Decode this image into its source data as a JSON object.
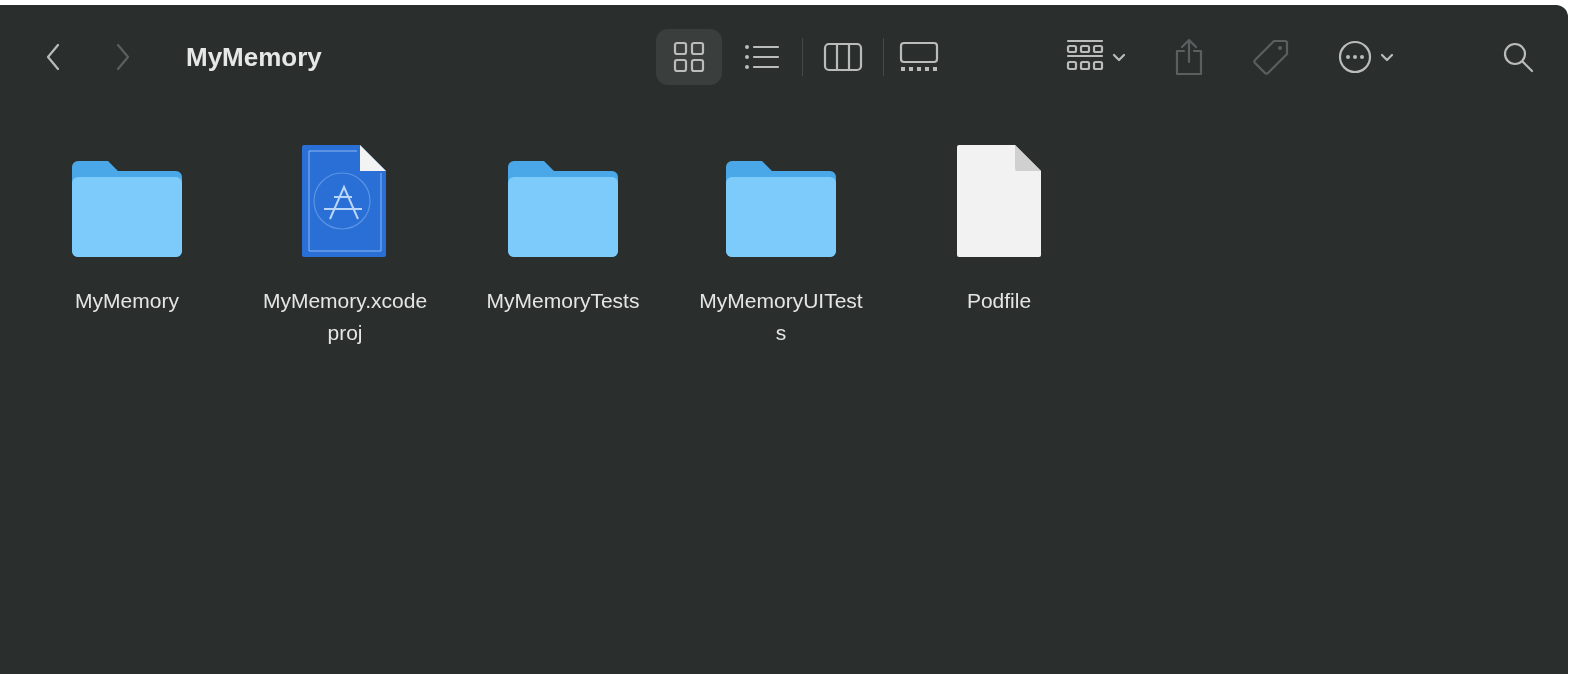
{
  "window": {
    "title": "MyMemory"
  },
  "navigation": [
    {
      "kind": "back",
      "disabled": false
    },
    {
      "kind": "forward",
      "disabled": true
    }
  ],
  "view_modes": [
    {
      "kind": "icons",
      "selected": true
    },
    {
      "kind": "list",
      "selected": false
    },
    {
      "kind": "columns",
      "selected": false
    },
    {
      "kind": "gallery",
      "selected": false
    }
  ],
  "toolbar": [
    {
      "kind": "group",
      "disabled": false
    },
    {
      "kind": "share",
      "disabled": true
    },
    {
      "kind": "tag",
      "disabled": true
    },
    {
      "kind": "more",
      "disabled": false
    },
    {
      "kind": "search",
      "disabled": false
    }
  ],
  "files": [
    {
      "kind": "folder",
      "label_lines": [
        "MyMemory"
      ]
    },
    {
      "kind": "xcodeproj",
      "label_lines": [
        "MyMemory.xcode",
        "proj"
      ]
    },
    {
      "kind": "folder",
      "label_lines": [
        "MyMemoryTests"
      ]
    },
    {
      "kind": "folder",
      "label_lines": [
        "MyMemoryUITest",
        "s"
      ]
    },
    {
      "kind": "document",
      "label_lines": [
        "Podfile"
      ]
    }
  ]
}
